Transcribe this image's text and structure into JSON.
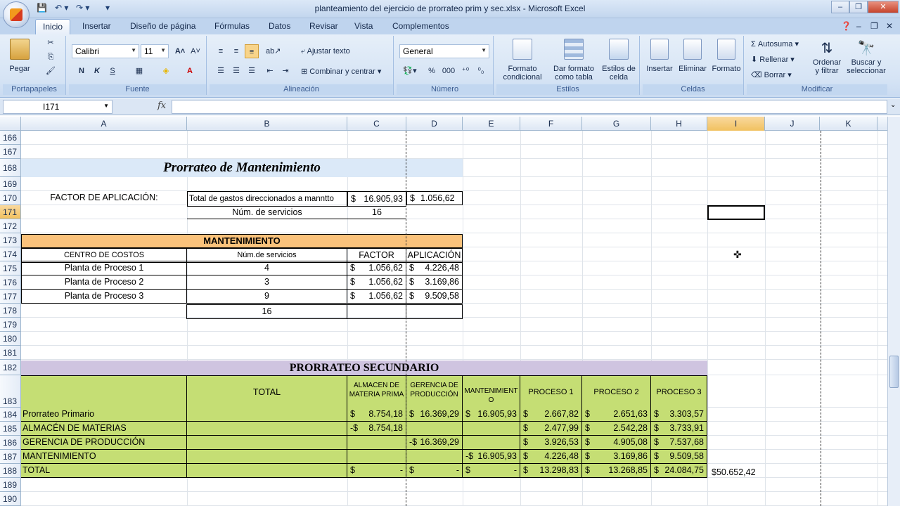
{
  "window": {
    "title": "planteamiento del ejercicio de prorrateo prim y sec.xlsx - Microsoft Excel"
  },
  "tabs": [
    "Inicio",
    "Insertar",
    "Diseño de página",
    "Fórmulas",
    "Datos",
    "Revisar",
    "Vista",
    "Complementos"
  ],
  "ribbon": {
    "portapapeles": {
      "paste": "Pegar",
      "label": "Portapapeles"
    },
    "fuente": {
      "font": "Calibri",
      "size": "11",
      "label": "Fuente"
    },
    "alineacion": {
      "wrap": "Ajustar texto",
      "merge": "Combinar y centrar",
      "label": "Alineación"
    },
    "numero": {
      "format": "General",
      "label": "Número"
    },
    "estilos": {
      "cond1": "Formato",
      "cond2": "condicional",
      "table1": "Dar formato",
      "table2": "como tabla",
      "cell1": "Estilos de",
      "cell2": "celda",
      "label": "Estilos"
    },
    "celdas": {
      "insert": "Insertar",
      "delete": "Eliminar",
      "format": "Formato",
      "label": "Celdas"
    },
    "modificar": {
      "autosum": "Autosuma",
      "fill": "Rellenar",
      "clear": "Borrar",
      "sort1": "Ordenar",
      "sort2": "y filtrar",
      "find1": "Buscar y",
      "find2": "seleccionar",
      "label": "Modificar"
    }
  },
  "formula_bar": {
    "name_box": "I171",
    "fx": "fx",
    "content": ""
  },
  "columns": [
    "A",
    "B",
    "C",
    "D",
    "E",
    "F",
    "G",
    "H",
    "I",
    "J",
    "K"
  ],
  "rows": [
    "166",
    "167",
    "168",
    "169",
    "170",
    "171",
    "172",
    "173",
    "174",
    "175",
    "176",
    "177",
    "178",
    "179",
    "180",
    "181",
    "182",
    "183",
    "184",
    "185",
    "186",
    "187",
    "188",
    "189",
    "190"
  ],
  "sheet": {
    "title_mant": "Prorrateo de Mantenimiento",
    "factor_label": "FACTOR DE APLICACIÓN:",
    "total_gastos_label": "Total de gastos direccionados a manntto",
    "total_gastos_value": "16.905,93",
    "factor_value": "1.056,62",
    "num_servicios_label": "Núm. de servicios",
    "num_servicios_value": "16",
    "mant_header": "MANTENIMIENTO",
    "col_headers": {
      "centro": "CENTRO DE COSTOS",
      "num": "Núm.de servicios",
      "factor": "FACTOR",
      "aplicacion": "APLICACIÓN"
    },
    "mant_rows": [
      {
        "name": "Planta de Proceso 1",
        "num": "4",
        "factor": "1.056,62",
        "apl": "4.226,48"
      },
      {
        "name": "Planta de Proceso 2",
        "num": "3",
        "factor": "1.056,62",
        "apl": "3.169,86"
      },
      {
        "name": "Planta de Proceso 3",
        "num": "9",
        "factor": "1.056,62",
        "apl": "9.509,58"
      }
    ],
    "mant_total": "16",
    "sec_title": "PRORRATEO SECUNDARIO",
    "sec_headers": {
      "total": "TOTAL",
      "almacen": "ALMACEN DE MATERIA PRIMA",
      "gerencia": "GERENCIA DE PRODUCCIÓN",
      "mant": "MANTENIMIENTO",
      "p1": "PROCESO 1",
      "p2": "PROCESO 2",
      "p3": "PROCESO 3"
    },
    "sec_rows": [
      {
        "label": "Prorrateo Primario",
        "c": "$ 8.754,18",
        "d": "$16.369,29",
        "e": "$16.905,93",
        "f": "$ 2.667,82",
        "g": "$ 2.651,63",
        "h": "$ 3.303,57"
      },
      {
        "label": "ALMACÉN DE MATERIAS",
        "c": "-$ 8.754,18",
        "d": "",
        "e": "",
        "f": "$2.477,99",
        "g": "$2.542,28",
        "h": "$3.733,91"
      },
      {
        "label": "GERENCIA DE PRODUCCIÓN",
        "c": "",
        "d": "-$16.369,29",
        "e": "",
        "f": "$ 3.926,53",
        "g": "$ 4.905,08",
        "h": "$ 7.537,68"
      },
      {
        "label": "MANTENIMIENTO",
        "c": "",
        "d": "",
        "e": "-$16.905,93",
        "f": "$ 4.226,48",
        "g": "$ 3.169,86",
        "h": "$ 9.509,58"
      },
      {
        "label": "TOTAL",
        "c": "$ -",
        "d": "$ -",
        "e": "$ -",
        "f": "$ 13.298,83",
        "g": "$ 13.268,85",
        "h": "$24.084,75"
      }
    ],
    "grand_total": "$50.652,42"
  }
}
